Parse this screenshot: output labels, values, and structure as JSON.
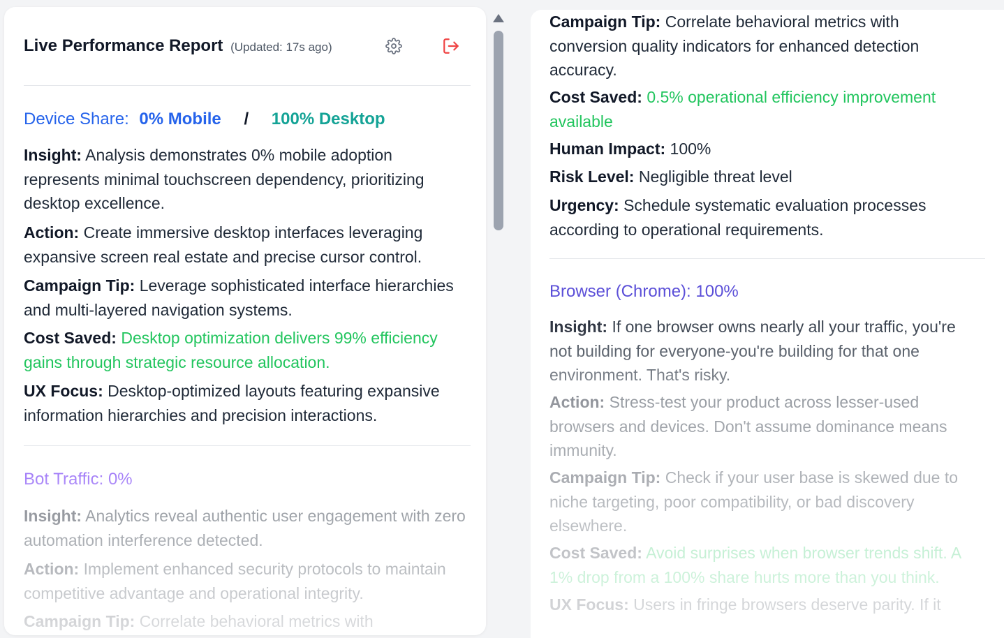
{
  "header": {
    "title": "Live Performance Report",
    "updated": "(Updated: 17s ago)",
    "settings_icon": "gear-icon",
    "logout_icon": "logout-icon"
  },
  "colors": {
    "device_title": "#2563eb",
    "desktop_title": "#14a396",
    "bot_title": "#8b5cf6",
    "browser_title": "#5b4fd8",
    "cost_saved": "#22c55e",
    "logout_icon": "#ef4444"
  },
  "left": {
    "device": {
      "label": "Device Share:",
      "mobile": "0% Mobile",
      "separator": "/",
      "desktop": "100% Desktop",
      "insight_label": "Insight:",
      "insight": "Analysis demonstrates 0% mobile adoption represents minimal touchscreen dependency, prioritizing desktop excellence.",
      "action_label": "Action:",
      "action": "Create immersive desktop interfaces leveraging expansive screen real estate and precise cursor control.",
      "tip_label": "Campaign Tip:",
      "tip": "Leverage sophisticated interface hierarchies and multi-layered navigation systems.",
      "cost_label": "Cost Saved:",
      "cost": "Desktop optimization delivers 99% efficiency gains through strategic resource allocation.",
      "ux_label": "UX Focus:",
      "ux": "Desktop-optimized layouts featuring expansive information hierarchies and precision interactions."
    },
    "bot": {
      "title": "Bot Traffic: 0%",
      "insight_label": "Insight:",
      "insight": "Analytics reveal authentic user engagement with zero automation interference detected.",
      "action_label": "Action:",
      "action": "Implement enhanced security protocols to maintain competitive advantage and operational integrity.",
      "tip_label": "Campaign Tip:",
      "tip": "Correlate behavioral metrics with"
    }
  },
  "right": {
    "bot_cont": {
      "tip_label": "Campaign Tip:",
      "tip": "Correlate behavioral metrics with conversion quality indicators for enhanced detection accuracy.",
      "cost_label": "Cost Saved:",
      "cost": "0.5% operational efficiency improvement available",
      "human_label": "Human Impact:",
      "human": "100%",
      "risk_label": "Risk Level:",
      "risk": "Negligible threat level",
      "urgency_label": "Urgency:",
      "urgency": "Schedule systematic evaluation processes according to operational requirements."
    },
    "browser": {
      "title": "Browser (Chrome): 100%",
      "insight_label": "Insight:",
      "insight": "If one browser owns nearly all your traffic, you're not building for everyone-you're building for that one environment. That's risky.",
      "action_label": "Action:",
      "action": "Stress-test your product across lesser-used browsers and devices. Don't assume dominance means immunity.",
      "tip_label": "Campaign Tip:",
      "tip": "Check if your user base is skewed due to niche targeting, poor compatibility, or bad discovery elsewhere.",
      "cost_label": "Cost Saved:",
      "cost": "Avoid surprises when browser trends shift. A 1% drop from a 100% share hurts more than you think.",
      "ux_label": "UX Focus:",
      "ux": "Users in fringe browsers deserve parity. If it"
    }
  }
}
